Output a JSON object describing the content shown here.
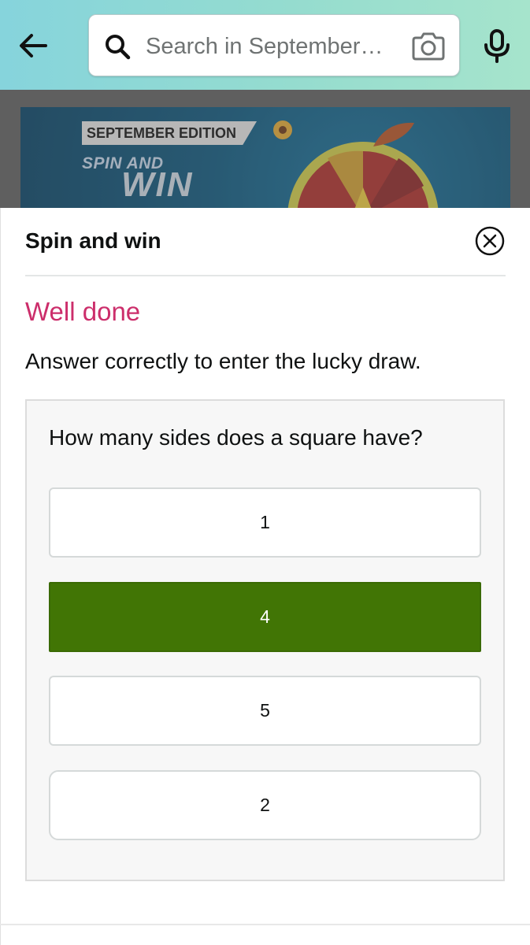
{
  "header": {
    "search_placeholder": "Search in September…",
    "colors": {
      "gradient_start": "#86d4dc",
      "gradient_end": "#a6e4cc"
    },
    "icons": {
      "back": "arrow-left-icon",
      "search": "search-icon",
      "camera": "camera-icon",
      "mic": "microphone-icon"
    }
  },
  "banner": {
    "tag": "SEPTEMBER EDITION",
    "line1": "SPIN AND",
    "line2": "WIN"
  },
  "modal": {
    "title": "Spin and win",
    "close_icon": "close-circle-icon",
    "status": "Well done",
    "status_color": "#cc2e6b",
    "instruction": "Answer correctly to enter the lucky draw.",
    "question": "How many sides does a square have?",
    "options": [
      {
        "label": "1",
        "selected": false
      },
      {
        "label": "4",
        "selected": true
      },
      {
        "label": "5",
        "selected": false
      },
      {
        "label": "2",
        "selected": false
      }
    ],
    "correct_color": "#417505"
  }
}
